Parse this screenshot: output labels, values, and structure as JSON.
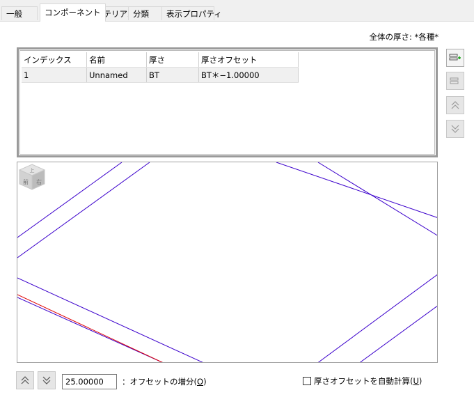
{
  "tabs": [
    {
      "label": "一般"
    },
    {
      "label": "コンポーネント",
      "active": true
    },
    {
      "label": "マテリアル"
    },
    {
      "label": "分類"
    },
    {
      "label": "表示プロパティ"
    }
  ],
  "total_thickness_label": "全体の厚さ: *各種*",
  "table": {
    "headers": [
      "インデックス",
      "名前",
      "厚さ",
      "厚さオフセット"
    ],
    "rows": [
      [
        "1",
        "Unnamed",
        "BT",
        "BT＊−1.00000"
      ]
    ]
  },
  "viewcube": {
    "top_label": "上",
    "front_label": "前",
    "right_label": "右"
  },
  "side_buttons": {
    "add_icon": "add-row-icon",
    "remove_icon": "remove-row-icon",
    "up_icon": "move-up-icon",
    "down_icon": "move-down-icon"
  },
  "offset": {
    "value": "25.00000",
    "label_prefix": "：オフセットの増分(",
    "label_key": "O",
    "label_suffix": ")"
  },
  "auto_calc": {
    "label_prefix": "厚さオフセットを自動計算(",
    "label_key": "U",
    "label_suffix": ")",
    "checked": false
  },
  "colors": {
    "line_blue": "#3b00cc",
    "line_red": "#e00000"
  }
}
